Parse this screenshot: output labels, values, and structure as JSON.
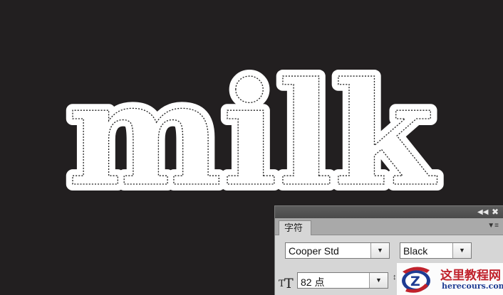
{
  "canvas": {
    "artwork_text": "milk",
    "background_color": "#221f20",
    "text_color": "#ffffff"
  },
  "character_panel": {
    "collapse_icon": "double-arrow-left-icon",
    "close_icon": "close-icon",
    "tab_label": "字符",
    "panel_menu_icon": "panel-menu-icon",
    "font_family": "Cooper Std",
    "font_style": "Black",
    "font_size": "82 点",
    "font_size_icon": "font-size-icon",
    "leading_icon": "leading-icon"
  },
  "watermark": {
    "text_cn": "这里教程网",
    "text_en": "herecours.com",
    "logo_letter": "Z"
  }
}
